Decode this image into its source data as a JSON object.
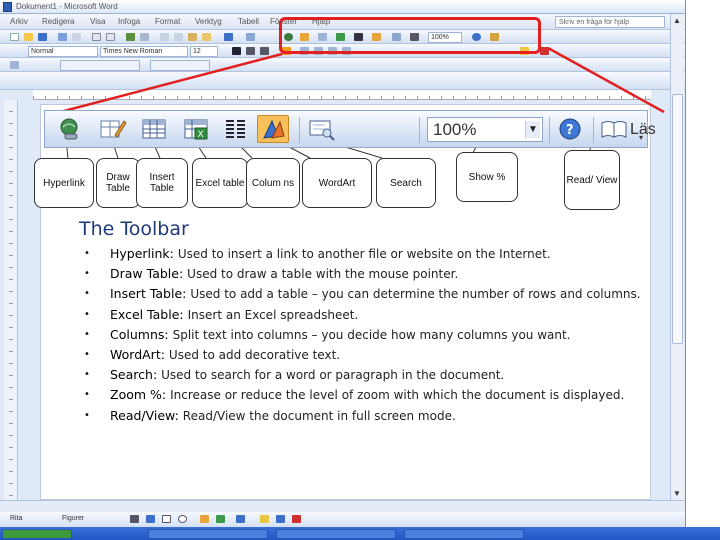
{
  "window": {
    "title": "Dokument1 - Microsoft Word",
    "help_placeholder": "Skriv en fråga för hjälp",
    "menus": [
      "Arkiv",
      "Redigera",
      "Visa",
      "Infoga",
      "Format",
      "Verktyg",
      "Tabell",
      "Fönster",
      "Hjälp"
    ],
    "style_value": "Normal",
    "font_value": "Times New Roman",
    "size_value": "12",
    "drawbar_label": "Rita",
    "autoshapes_label": "Figurer"
  },
  "toolbar_zoom": {
    "zoom_value": "100%",
    "read_label": "Läs"
  },
  "callouts": {
    "hyperlink": "Hyperlink",
    "draw_table": "Draw Table",
    "insert_table": "Insert Table",
    "excel_table": "Excel table",
    "columns": "Colum ns",
    "wordart": "WordArt",
    "search": "Search",
    "show_pct": "Show %",
    "read_view": "Read/ View"
  },
  "content": {
    "heading": "The Toolbar",
    "items": [
      {
        "term": "Hyperlink:",
        "desc": "Used to insert a link to another file or website on the Internet."
      },
      {
        "term": "Draw Table:",
        "desc": "Used to draw a table with the mouse pointer."
      },
      {
        "term": "Insert Table:",
        "desc": "Used to add a table – you can determine the number of rows and columns."
      },
      {
        "term": "Excel Table:",
        "desc": "Insert an Excel spreadsheet."
      },
      {
        "term": "Columns:",
        "desc": "Split text into columns – you decide how many columns you want."
      },
      {
        "term": "WordArt:",
        "desc": "Used to add decorative text."
      },
      {
        "term": "Search:",
        "desc": "Used to search for a word or paragraph in the document."
      },
      {
        "term": "Zoom %:",
        "desc": "Increase or reduce the level of zoom with which the document is displayed."
      },
      {
        "term": "Read/View:",
        "desc": "Read/View the document in full screen mode."
      }
    ]
  },
  "colors": {
    "highlight": "#e32020",
    "heading": "#1f3a7a",
    "toolbar": "#d4e0f3"
  }
}
